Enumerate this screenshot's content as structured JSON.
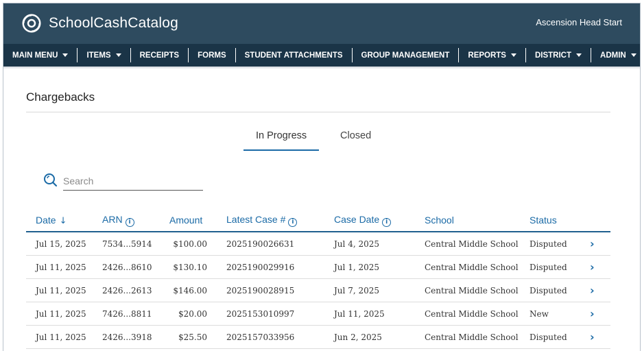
{
  "app": {
    "brand": "SchoolCashCatalog",
    "org": "Ascension Head Start"
  },
  "nav": [
    {
      "label": "MAIN MENU",
      "dropdown": true
    },
    {
      "label": "ITEMS",
      "dropdown": true
    },
    {
      "label": "RECEIPTS",
      "dropdown": false
    },
    {
      "label": "FORMS",
      "dropdown": false
    },
    {
      "label": "STUDENT ATTACHMENTS",
      "dropdown": false
    },
    {
      "label": "GROUP MANAGEMENT",
      "dropdown": false
    },
    {
      "label": "REPORTS",
      "dropdown": true
    },
    {
      "label": "DISTRICT",
      "dropdown": true
    },
    {
      "label": "ADMIN",
      "dropdown": true
    }
  ],
  "page": {
    "title": "Chargebacks"
  },
  "tabs": [
    {
      "label": "In Progress",
      "active": true
    },
    {
      "label": "Closed",
      "active": false
    }
  ],
  "search": {
    "placeholder": "Search"
  },
  "table": {
    "headers": {
      "date": "Date",
      "arn": "ARN",
      "amount": "Amount",
      "case": "Latest Case #",
      "case_date": "Case Date",
      "school": "School",
      "status": "Status"
    },
    "rows": [
      {
        "date": "Jul 15, 2025",
        "arn": "7534...5914",
        "amount": "$100.00",
        "case": "2025190026631",
        "case_date": "Jul 4, 2025",
        "school": "Central Middle School",
        "status": "Disputed"
      },
      {
        "date": "Jul 11, 2025",
        "arn": "2426...8610",
        "amount": "$130.10",
        "case": "2025190029916",
        "case_date": "Jul 1, 2025",
        "school": "Central Middle School",
        "status": "Disputed"
      },
      {
        "date": "Jul 11, 2025",
        "arn": "2426...2613",
        "amount": "$146.00",
        "case": "2025190028915",
        "case_date": "Jul 7, 2025",
        "school": "Central Middle School",
        "status": "Disputed"
      },
      {
        "date": "Jul 11, 2025",
        "arn": "7426...8811",
        "amount": "$20.00",
        "case": "2025153010997",
        "case_date": "Jul 11, 2025",
        "school": "Central Middle School",
        "status": "New"
      },
      {
        "date": "Jul 11, 2025",
        "arn": "2426...3918",
        "amount": "$25.50",
        "case": "2025157033956",
        "case_date": "Jun 2, 2025",
        "school": "Central Middle School",
        "status": "Disputed"
      }
    ]
  },
  "colors": {
    "header_bg": "#2e4b5f",
    "nav_bg": "#1a3447",
    "accent": "#1a6aa6"
  },
  "icons": {
    "logo": "swirl-logo-icon",
    "search": "search-icon",
    "sort": "arrow-down-icon",
    "info": "info-icon",
    "row_action": "chevron-right-icon"
  }
}
